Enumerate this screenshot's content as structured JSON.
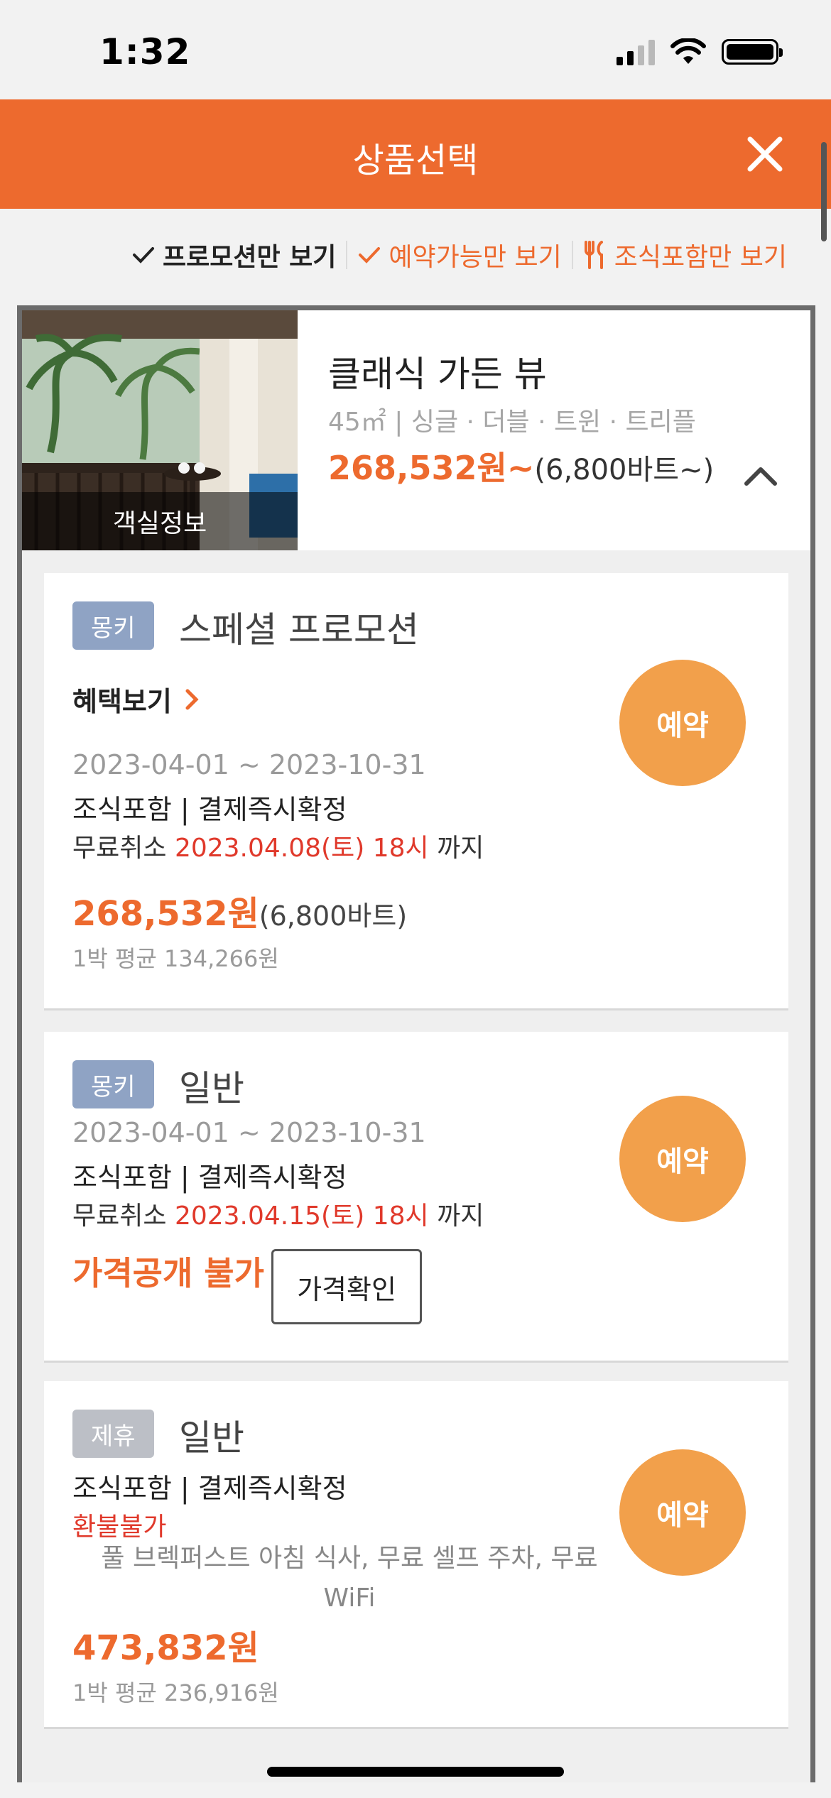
{
  "status": {
    "time": "1:32"
  },
  "header": {
    "title": "상품선택"
  },
  "filters": {
    "promo": "프로모션만 보기",
    "available": "예약가능만 보기",
    "breakfast": "조식포함만 보기"
  },
  "room": {
    "photo_label": "객실정보",
    "name": "클래식 가든 뷰",
    "specs": "45㎡ | 싱글 · 더블 · 트윈 · 트리플",
    "price": "268,532원~",
    "price_sub": "(6,800바트~)"
  },
  "plans": [
    {
      "badge": "몽키",
      "name": "스페셜 프로모션",
      "benefit": "혜택보기",
      "dates": "2023-04-01 ~ 2023-10-31",
      "conditions": "조식포함 | 결제즉시확정",
      "cancel_prefix": "무료취소 ",
      "cancel_date": "2023.04.08(토) 18시",
      "cancel_suffix": " 까지",
      "price": "268,532원",
      "price_sub": "(6,800바트)",
      "avg": "1박 평균 134,266원",
      "book": "예약"
    },
    {
      "badge": "몽키",
      "name": "일반",
      "dates": "2023-04-01 ~ 2023-10-31",
      "conditions": "조식포함 | 결제즉시확정",
      "cancel_prefix": "무료취소 ",
      "cancel_date": "2023.04.15(토) 18시",
      "cancel_suffix": " 까지",
      "price_na": "가격공개 불가",
      "check_price": "가격확인",
      "book": "예약"
    },
    {
      "badge": "제휴",
      "name": "일반",
      "conditions": "조식포함 | 결제즉시확정",
      "refund": "환불불가",
      "amenities": "풀 브렉퍼스트 아침 식사, 무료 셀프 주차, 무료 WiFi",
      "price": "473,832원",
      "avg": "1박 평균 236,916원",
      "book": "예약"
    }
  ],
  "colors": {
    "accent": "#ed6a2e",
    "book_button": "#f2a04b",
    "badge_blue": "#8fa3c4",
    "badge_gray": "#bcbfc6",
    "cancel_red": "#e0392b"
  }
}
